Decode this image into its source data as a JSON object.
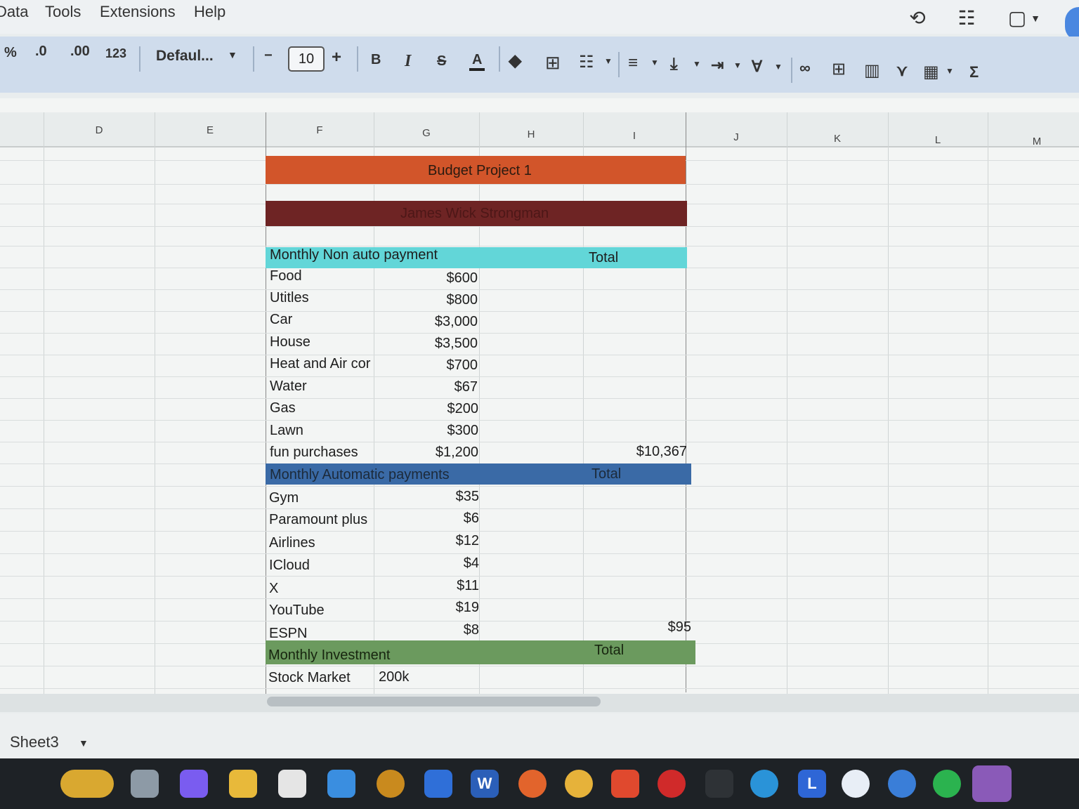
{
  "menu": {
    "items": [
      "Data",
      "Tools",
      "Extensions",
      "Help"
    ]
  },
  "toolbar": {
    "percent": "%",
    "decrease_decimal": ".0",
    "increase_decimal": ".00",
    "number_format": "123",
    "font_name": "Defaul...",
    "minus": "−",
    "font_size": "10",
    "plus": "+",
    "bold": "B",
    "italic": "I",
    "strike": "S",
    "text_color": "A",
    "sum": "Σ"
  },
  "columns": [
    "D",
    "E",
    "F",
    "G",
    "H",
    "I",
    "J",
    "K",
    "L",
    "M"
  ],
  "sheet": {
    "title": "Budget Project 1",
    "author": "James Wick Strongman",
    "section1": {
      "header": "Monthly Non auto payment",
      "total_label": "Total",
      "rows": [
        {
          "label": "Food",
          "value": "$600"
        },
        {
          "label": "Utitles",
          "value": "$800"
        },
        {
          "label": "Car",
          "value": "$3,000"
        },
        {
          "label": "House",
          "value": "$3,500"
        },
        {
          "label": "Heat and Air cor",
          "value": "$700"
        },
        {
          "label": "Water",
          "value": "$67"
        },
        {
          "label": "Gas",
          "value": "$200"
        },
        {
          "label": "Lawn",
          "value": "$300"
        },
        {
          "label": "fun purchases",
          "value": "$1,200"
        }
      ],
      "total": "$10,367"
    },
    "section2": {
      "header": "Monthly Automatic payments",
      "total_label": "Total",
      "rows": [
        {
          "label": "Gym",
          "value": "$35"
        },
        {
          "label": "Paramount plus",
          "value": "$6"
        },
        {
          "label": "Airlines",
          "value": "$12"
        },
        {
          "label": "ICloud",
          "value": "$4"
        },
        {
          "label": "X",
          "value": "$11"
        },
        {
          "label": "YouTube",
          "value": "$19"
        },
        {
          "label": "ESPN",
          "value": "$8"
        }
      ],
      "total": "$95"
    },
    "section3": {
      "header": "Monthly Investment",
      "total_label": "Total",
      "rows": [
        {
          "label": "Stock Market",
          "value": "200k"
        }
      ]
    }
  },
  "sheet_tab": "Sheet3",
  "colors": {
    "title_band": "#d2552a",
    "author_band": "#6e2424",
    "section1_band": "#62d6d8",
    "section2_band": "#3a6aa6",
    "section3_band": "#6b9a5e"
  },
  "taskbar_icons": [
    "widgets-icon",
    "task-view-icon",
    "copilot-icon",
    "file-explorer-icon",
    "store-icon",
    "mail-icon",
    "game-icon",
    "bing-icon",
    "word-icon",
    "firefox-icon",
    "chrome-icon",
    "brave-icon",
    "opera-icon",
    "terminal-icon",
    "edge-icon",
    "l-app-icon",
    "steam-icon",
    "ccleaner-icon",
    "spotify-icon",
    "notes-icon"
  ],
  "taskbar_labels": {
    "word": "W",
    "l_app": "L"
  }
}
